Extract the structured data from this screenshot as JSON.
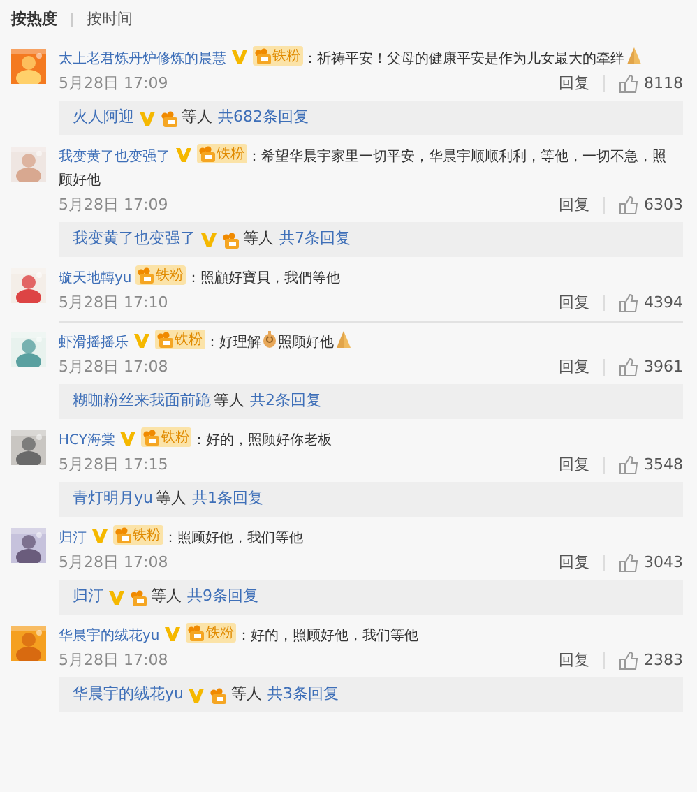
{
  "sort_tabs": [
    {
      "label": "按热度",
      "selected": true
    },
    {
      "label": "按时间",
      "selected": false
    }
  ],
  "comments": [
    {
      "name": "太上老君炼丹炉修炼的晨慧",
      "verified": true,
      "fan_badge": "铁粉",
      "content": [
        {
          "kind": "text",
          "text": "：祈祷平安！父母的健康平安是作为儿女最大的牵绊"
        },
        {
          "kind": "pray"
        }
      ],
      "time": "5月28日 17:09",
      "reply_label": "回复",
      "likes": "8118",
      "replies": {
        "user": "火人阿迎",
        "verified": true,
        "badge": true,
        "others": "等人",
        "count": "共682条回复"
      }
    },
    {
      "name": "我变黄了也变强了",
      "verified": true,
      "fan_badge": "铁粉",
      "content": [
        {
          "kind": "text",
          "text": "：希望华晨宇家里一切平安，华晨宇顺顺利利，等他，一切不急，照"
        },
        {
          "kind": "next_line",
          "text": "顾好他"
        }
      ],
      "time": "5月28日 17:09",
      "reply_label": "回复",
      "likes": "6303",
      "replies": {
        "user": "我变黄了也变强了",
        "verified": true,
        "badge": true,
        "others": "等人",
        "count": "共7条回复"
      }
    },
    {
      "name": "璇天地轉yu",
      "verified": false,
      "fan_badge": "铁粉",
      "content": [
        {
          "kind": "text",
          "text": "：照顧好寶貝，我們等他"
        }
      ],
      "time": "5月28日 17:10",
      "reply_label": "回复",
      "likes": "4394"
    },
    {
      "name": "虾滑摇摇乐",
      "verified": true,
      "fan_badge": "铁粉",
      "content": [
        {
          "kind": "text",
          "text": "：好理解"
        },
        {
          "kind": "hand"
        },
        {
          "kind": "text",
          "text": "照顾好他"
        },
        {
          "kind": "pray"
        }
      ],
      "time": "5月28日 17:08",
      "reply_label": "回复",
      "likes": "3961",
      "replies": {
        "user": "糊咖粉丝来我面前跪",
        "verified": false,
        "badge": false,
        "others": "等人",
        "count": "共2条回复"
      }
    },
    {
      "name": "HCY海棠",
      "verified": true,
      "fan_badge": "铁粉",
      "content": [
        {
          "kind": "text",
          "text": "：好的，照顾好你老板"
        }
      ],
      "time": "5月28日 17:15",
      "reply_label": "回复",
      "likes": "3548",
      "replies": {
        "user": "青灯明月yu",
        "verified": false,
        "badge": false,
        "others": "等人",
        "count": "共1条回复"
      }
    },
    {
      "name": "归汀",
      "verified": true,
      "fan_badge": "铁粉",
      "content": [
        {
          "kind": "text",
          "text": "：照顾好他，我们等他"
        }
      ],
      "time": "5月28日 17:08",
      "reply_label": "回复",
      "likes": "3043",
      "replies": {
        "user": "归汀",
        "verified": true,
        "badge": true,
        "others": "等人",
        "count": "共9条回复"
      }
    },
    {
      "name": "华晨宇的绒花yu",
      "verified": true,
      "fan_badge": "铁粉",
      "content": [
        {
          "kind": "text",
          "text": "：好的，照顾好他，我们等他"
        }
      ],
      "time": "5月28日 17:08",
      "reply_label": "回复",
      "likes": "2383",
      "replies": {
        "user": "华晨宇的绒花yu",
        "verified": true,
        "badge": true,
        "others": "等人",
        "count": "共3条回复"
      }
    }
  ]
}
